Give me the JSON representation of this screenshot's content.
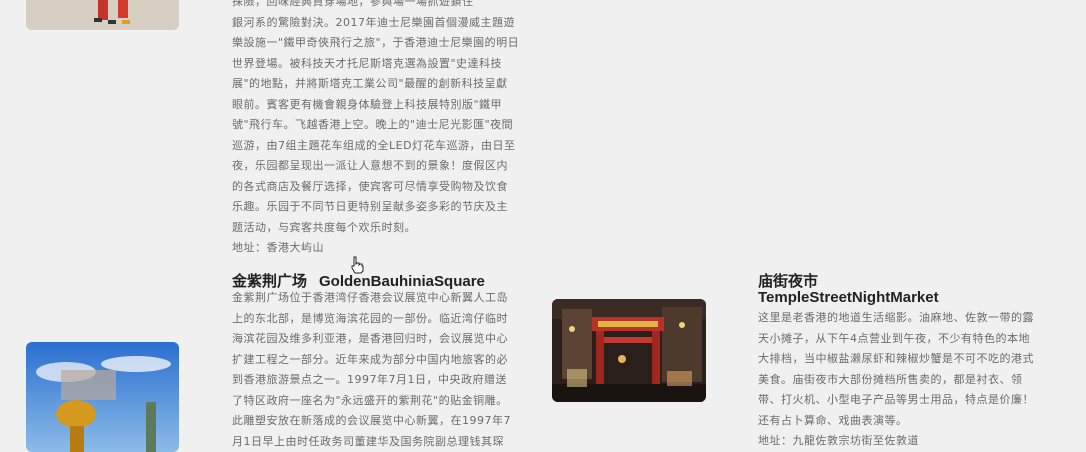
{
  "disney": {
    "lines": [
      "探險，回味經典貫穿場地，參與場一場抓遊鎖住",
      "銀河系的驚險對決。2017年迪士尼樂園首個漫威主題遊",
      "樂設施一\"鐵甲奇俠飛行之旅\"，于香港迪士尼樂園的明日",
      "世界登場。被科技天才托尼斯塔克選為設置\"史達科技",
      "展\"的地點，并將斯塔克工業公司\"最醒的創新科技呈獻",
      "眼前。賓客更有機會親身体驗登上科技展特別版\"鐵甲",
      "號\"飛行车。飞越香港上空。晚上的\"迪士尼光影匯\"夜間",
      "巡游，由7组主題花车组成的全LED灯花车巡游，由日至",
      "夜，乐园都呈现出一派让人意想不到的景象！度假区内",
      "的各式商店及餐厅选择，使宾客可尽情享受购物及饮食",
      "乐趣。乐园于不同节日更特别呈献多姿多彩的节庆及主",
      "题活动，与宾客共度每个欢乐时刻。"
    ],
    "address": "地址：香港大屿山"
  },
  "bauhinia": {
    "title_cn": "金紫荆广场",
    "title_en": "GoldenBauhiniaSquare",
    "lines": [
      "金紫荆广场位于香港湾仔香港会议展览中心新翼人工岛",
      "上的东北部，是博览海滨花园的一部份。临近湾仔临时",
      "海滨花园及维多利亚港，是香港回归时，会议展览中心",
      "扩建工程之一部分。近年来成为部分中国内地旅客的必",
      "到香港旅游景点之一。1997年7月1日，中央政府赠送",
      "了特区政府一座名为\"永远盛开的紫荆花\"的贴金铜雕。",
      "此雕塑安放在新落成的会议展览中心新翼，在1997年7",
      "月1日早上由时任政务司董建华及国务院副总理钱其琛"
    ]
  },
  "temple": {
    "title_cn": "庙街夜市",
    "title_en": "TempleStreetNightMarket",
    "lines": [
      "这里是老香港的地道生活缩影。油麻地、佐敦一带的露",
      "天小摊子，从下午4点营业到午夜，不少有特色的本地",
      "大排档，当中椒盐濑尿虾和辣椒炒蟹是不可不吃的港式",
      "美食。庙街夜市大部份摊档所售卖的，都是衬衣、领",
      "带、打火机、小型电子产品等男士用品，特点是价廉！",
      "还有占卜算命、戏曲表演等。"
    ],
    "address": "地址：九龍佐敦宗坊街至佐敦道"
  }
}
